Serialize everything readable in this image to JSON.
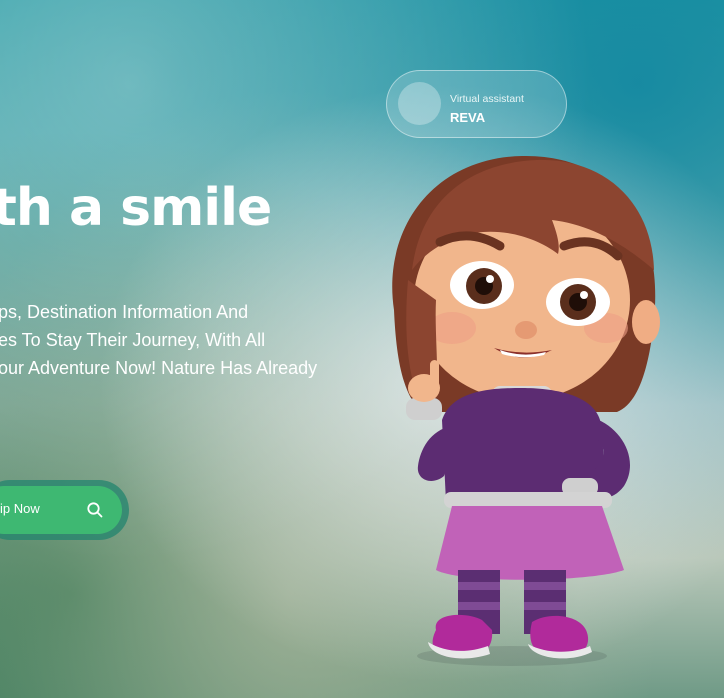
{
  "hero": {
    "headline": "th a smile",
    "description_lines": [
      "ps, Destination Information And",
      "es To Stay Their Journey, With All",
      "our Adventure Now! Nature Has Already"
    ],
    "cta_label": "ip Now",
    "cta_icon": "search-icon"
  },
  "assistant": {
    "title": "Virtual assistant",
    "name": "REVA"
  },
  "colors": {
    "accent": "#3eb872",
    "text": "#ffffff"
  }
}
